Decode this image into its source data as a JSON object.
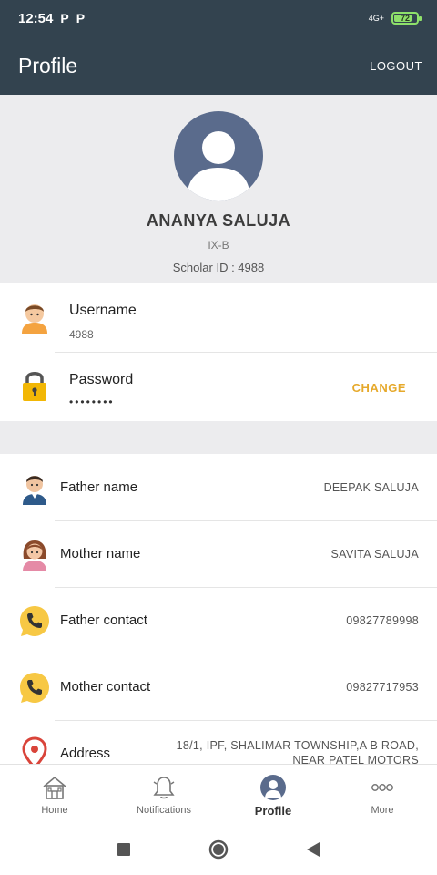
{
  "status_bar": {
    "time": "12:54",
    "notif_a": "P",
    "notif_b": "P",
    "signal": "4G+",
    "battery": "72"
  },
  "app_bar": {
    "title": "Profile",
    "logout_label": "LOGOUT"
  },
  "profile": {
    "name": "ANANYA SALUJA",
    "class": "IX-B",
    "scholar_id": "Scholar ID : 4988"
  },
  "credentials": {
    "username_label": "Username",
    "username_value": "4988",
    "password_label": "Password",
    "password_value": "••••••••",
    "change_label": "CHANGE"
  },
  "details": [
    {
      "label": "Father name",
      "value": "DEEPAK SALUJA"
    },
    {
      "label": "Mother name",
      "value": "SAVITA SALUJA"
    },
    {
      "label": "Father contact",
      "value": "09827789998"
    },
    {
      "label": "Mother contact",
      "value": "09827717953"
    },
    {
      "label": "Address",
      "value": "18/1, IPF, SHALIMAR TOWNSHIP,A B ROAD, NEAR PATEL MOTORS"
    }
  ],
  "bottom_nav": [
    {
      "label": "Home"
    },
    {
      "label": "Notifications"
    },
    {
      "label": "Profile"
    },
    {
      "label": "More"
    }
  ],
  "colors": {
    "header": "#33434f",
    "accent": "#e6a92b",
    "avatar": "#5a6b8c"
  }
}
